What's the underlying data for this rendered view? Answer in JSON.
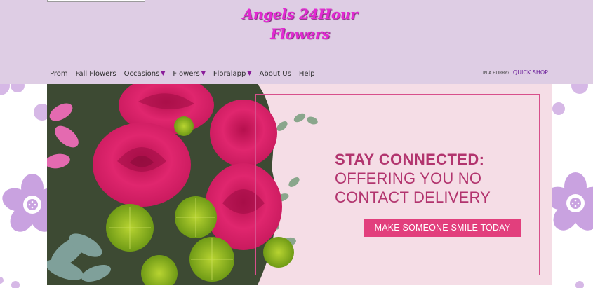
{
  "header": {
    "logo_line1": "Angels 24Hour",
    "logo_line2": "Flowers"
  },
  "nav": {
    "items": [
      {
        "label": "Prom",
        "has_dropdown": false
      },
      {
        "label": "Fall Flowers",
        "has_dropdown": false
      },
      {
        "label": "Occasions",
        "has_dropdown": true
      },
      {
        "label": "Flowers",
        "has_dropdown": true
      },
      {
        "label": "Floralapp",
        "has_dropdown": true
      },
      {
        "label": "About Us",
        "has_dropdown": false
      },
      {
        "label": "Help",
        "has_dropdown": false
      }
    ]
  },
  "quick_shop": {
    "prefix": "IN A HURRY?",
    "label": "QUICK SHOP"
  },
  "banner": {
    "headline": "STAY CONNECTED:",
    "subline": "OFFERING YOU NO CONTACT DELIVERY",
    "cta_label": "MAKE SOMEONE SMILE TODAY"
  },
  "colors": {
    "header_bg": "#decde4",
    "logo": "#e22ad2",
    "accent_purple": "#8a1d9a",
    "banner_bg": "#f5dde6",
    "headline": "#b2346e",
    "cta_bg": "#e23f7d"
  },
  "icons": {
    "dropdown": "chevron-down-icon",
    "side_pattern": "flower-pattern"
  }
}
